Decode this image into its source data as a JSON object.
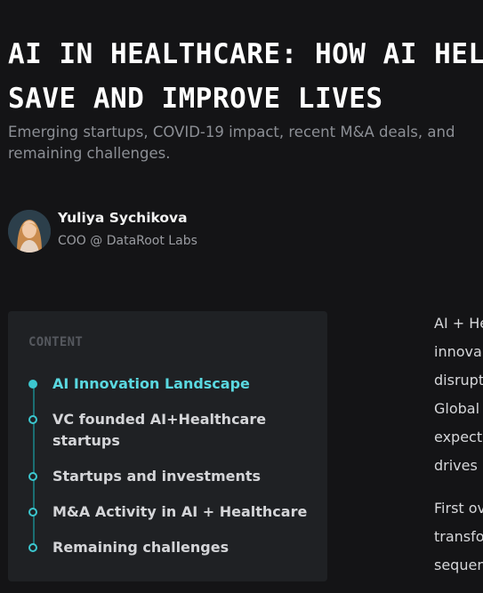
{
  "article": {
    "title_lines": [
      "AI in Healthcare: How AI helps",
      "save and improve lives"
    ],
    "subtitle": "Emerging startups, COVID-19 impact, recent M&A deals, and remaining challenges."
  },
  "author": {
    "name": "Yuliya Sychikova",
    "role": "COO @ DataRoot Labs"
  },
  "toc": {
    "heading": "Content",
    "items": [
      {
        "label": "AI Innovation Landscape",
        "active": true
      },
      {
        "label": "VC founded AI+Healthcare startups",
        "active": false
      },
      {
        "label": "Startups and investments",
        "active": false
      },
      {
        "label": "M&A Activity in AI + Healthcare",
        "active": false
      },
      {
        "label": "Remaining challenges",
        "active": false
      }
    ]
  },
  "body": {
    "paragraph_1": [
      "AI + He",
      "innova",
      "disrupt",
      "Global",
      "expect",
      "drives"
    ],
    "paragraph_2": [
      "First ov",
      "transfo",
      "sequen"
    ]
  },
  "colors": {
    "accent": "#3cc7cf",
    "background": "#141416",
    "panel": "#1f2124"
  }
}
